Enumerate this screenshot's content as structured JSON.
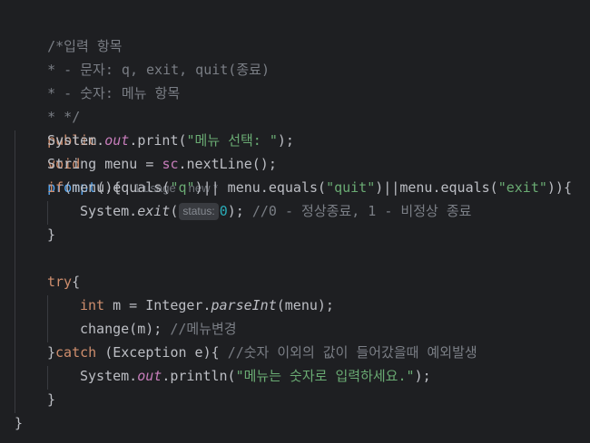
{
  "code": {
    "comment_1": "/*입력 항목",
    "comment_2": "* - 문자: q, exit, quit(종료)",
    "comment_3": "* - 숫자: 메뉴 항목",
    "comment_4": "* */",
    "sig": {
      "mod": "public",
      "ret": "void",
      "name": "prompt",
      "rest": "(){",
      "usage_hint": "1 usage",
      "new_hint": "new *"
    },
    "l6": {
      "a": "System.",
      "b": "out",
      "c": ".print(",
      "str": "\"메뉴 선택: \"",
      "d": ");"
    },
    "l7": {
      "a": "String menu = ",
      "b": "sc",
      "c": ".nextLine();"
    },
    "l8": {
      "kw": "if",
      "a": "(menu.equals(",
      "s1": "\"q\"",
      "b": ")|| menu.equals(",
      "s2": "\"quit\"",
      "c": ")||menu.equals(",
      "s3": "\"exit\"",
      "d": ")){"
    },
    "l9": {
      "a": "System.",
      "b": "exit",
      "c": "(",
      "param": "status:",
      "num": "0",
      "d": "); ",
      "cmt": "//0 - 정상종료, 1 - 비정상 종료"
    },
    "l10": "}",
    "l12": {
      "kw": "try",
      "a": "{"
    },
    "l13": {
      "kw": "int",
      "a": " m = Integer.",
      "b": "parseInt",
      "c": "(menu);"
    },
    "l14": {
      "a": "change(m); ",
      "cmt": "//메뉴변경"
    },
    "l15": {
      "a": "}",
      "kw": "catch",
      "b": " (Exception e){ ",
      "cmt": "//숫자 이외의 값이 들어갔을때 예외발생"
    },
    "l16": {
      "a": "System.",
      "b": "out",
      "c": ".println(",
      "str": "\"메뉴는 숫자로 입력하세요.\"",
      "d": ");"
    },
    "l17": "}",
    "l18": "}"
  }
}
